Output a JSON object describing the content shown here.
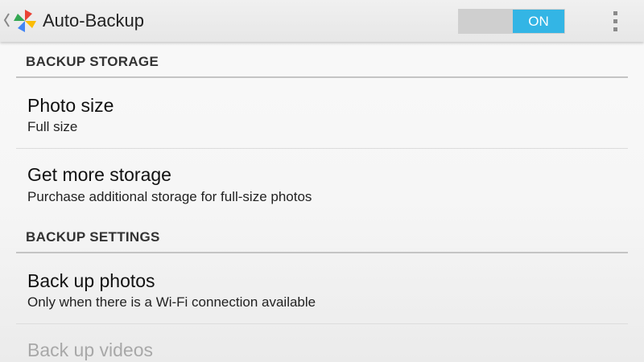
{
  "action_bar": {
    "title": "Auto-Backup",
    "toggle_label": "ON",
    "toggle_on": true,
    "accent_color": "#33b5e5"
  },
  "sections": [
    {
      "header": "BACKUP STORAGE",
      "items": [
        {
          "title": "Photo size",
          "summary": "Full size"
        },
        {
          "title": "Get more storage",
          "summary": "Purchase additional storage for full-size photos"
        }
      ]
    },
    {
      "header": "BACKUP SETTINGS",
      "items": [
        {
          "title": "Back up photos",
          "summary": "Only when there is a Wi-Fi connection available"
        },
        {
          "title": "Back up videos",
          "enabled": false
        }
      ]
    }
  ]
}
